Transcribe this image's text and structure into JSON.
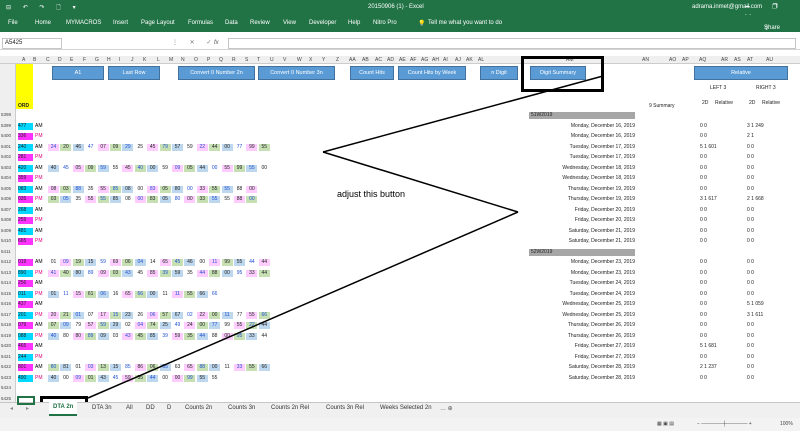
{
  "window": {
    "doc_title": "20150906 (1) - Excel",
    "email": "adrama.inmet@gmail.com",
    "qat": "⊟ ↶ ↷ 🗋 ▾",
    "controls": "🗕 ❐ ✕"
  },
  "ribbon": {
    "tabs": [
      "File",
      "Home",
      "MYMACROS",
      "Insert",
      "Page Layout",
      "Formulas",
      "Data",
      "Review",
      "View",
      "Developer",
      "Help",
      "Nitro Pro"
    ],
    "tell_me": "Tell me what you want to do",
    "share": "Share"
  },
  "formula_bar": {
    "name_box": "A5425",
    "fx": "fx",
    "icons": "⋮ ✕ ✓"
  },
  "columns": [
    "A",
    "B",
    "C",
    "D",
    "E",
    "F",
    "G",
    "H",
    "I",
    "J",
    "K",
    "L",
    "M",
    "N",
    "O",
    "P",
    "Q",
    "R",
    "S",
    "T",
    "U",
    "V",
    "W",
    "X",
    "Y",
    "Z",
    "AA",
    "AB",
    "AC",
    "AD",
    "AE",
    "AF",
    "AG",
    "AH",
    "AI",
    "AJ",
    "AK",
    "AL",
    "AM",
    "AN",
    "AO",
    "AP",
    "AQ",
    "AR",
    "AS",
    "AT",
    "AU"
  ],
  "buttons": [
    "A1",
    "Last Row",
    "Convert 0 Number 2n",
    "Convert 0 Number 3n",
    "Count Hits",
    "Count Hits by Week",
    "n Digit",
    "Digit Summary",
    "Relative"
  ],
  "header_cells": {
    "row1_num": "1",
    "col_a": "ORD",
    "nine_summary": "9 Summary",
    "left3": "LEFT 3",
    "right3": "RIGHT 3",
    "two_d": "2D",
    "relative": "Relative",
    "two_d_b": "2D",
    "relative_b": "Relative"
  },
  "row_numbers": [
    "5398",
    "5399",
    "5400",
    "5401",
    "5402",
    "5403",
    "5404",
    "5405",
    "5406",
    "5407",
    "5408",
    "5409",
    "5410",
    "5411",
    "5412",
    "5413",
    "5414",
    "5415",
    "5416",
    "5417",
    "5418",
    "5419",
    "5420",
    "5421",
    "5422",
    "5423",
    "5424",
    "5425",
    "5426"
  ],
  "rows": [
    {
      "a": "",
      "b": "",
      "nums": ""
    },
    {
      "a": "477",
      "b": "AM",
      "nums": ""
    },
    {
      "a": "336",
      "b": "PM",
      "nums": ""
    },
    {
      "a": "240",
      "b": "AM",
      "nums": "24 20 46 47 07 09 29 25 45 79 57 59 22 44 00 77 99 55"
    },
    {
      "a": "281",
      "b": "PM",
      "nums": ""
    },
    {
      "a": "420",
      "b": "AM",
      "nums": "40 45 05 09 59 55 45 40 00 59 09 05 44 00 55 99 55 00"
    },
    {
      "a": "359",
      "b": "PM",
      "nums": ""
    },
    {
      "a": "083",
      "b": "AM",
      "nums": "08 03 88 35 55 85 08 00 83 05 80 00 33 55 55 88 00"
    },
    {
      "a": "035",
      "b": "PM",
      "nums": "03 05 35 55 55 85 08 00 83 05 80 00 33 55 55 88 00"
    },
    {
      "a": "268",
      "b": "AM",
      "nums": ""
    },
    {
      "a": "259",
      "b": "PM",
      "nums": ""
    },
    {
      "a": "481",
      "b": "AM",
      "nums": ""
    },
    {
      "a": "665",
      "b": "PM",
      "nums": ""
    },
    {
      "a": "",
      "b": "",
      "nums": ""
    },
    {
      "a": "019",
      "b": "AM",
      "nums": "01 09 19 15 59 69 06 04 14 65 45 46 00 11 99 55 44 44"
    },
    {
      "a": "890",
      "b": "PM",
      "nums": "41 40 80 89 09 03 43 45 85 39 59 35 44 88 00 95 33 44"
    },
    {
      "a": "256",
      "b": "AM",
      "nums": ""
    },
    {
      "a": "011",
      "b": "PM",
      "nums": "01 11 15 61 06 16 65 66 00 11 11 55 66 66"
    },
    {
      "a": "437",
      "b": "AM",
      "nums": ""
    },
    {
      "a": "201",
      "b": "PM",
      "nums": "20 21 01 07 17 15 23 26 06 57 67 02 22 00 11 77 55 66"
    },
    {
      "a": "079",
      "b": "AM",
      "nums": "07 09 79 57 59 29 02 04 74 25 49 24 00 77 99 55 22 44"
    },
    {
      "a": "088",
      "b": "PM",
      "nums": "40 80 80 89 09 03 43 45 85 39 59 35 44 88 00 95 33 44"
    },
    {
      "a": "465",
      "b": "AM",
      "nums": ""
    },
    {
      "a": "244",
      "b": "PM",
      "nums": ""
    },
    {
      "a": "801",
      "b": "AM",
      "nums": "80 81 01 03 13 15 85 86 06 35 63 65 88 00 11 33 55 66"
    },
    {
      "a": "490",
      "b": "PM",
      "nums": "40 00 09 01 43 45 59 55 44 00 00 99 55 55"
    },
    {
      "a": "",
      "b": "",
      "nums": ""
    },
    {
      "a": "",
      "b": "",
      "nums": ""
    },
    {
      "a": "",
      "b": "",
      "nums": ""
    }
  ],
  "dates": [
    {
      "sep": "51W2019"
    },
    {
      "d": "Monday, December 16, 2019",
      "v": "0 0",
      "r": "3 1 249"
    },
    {
      "d": "Monday, December 16, 2019",
      "v": "0 0",
      "r": "2 1"
    },
    {
      "d": "Tuesday, December 17, 2019",
      "v": "5 1 601",
      "r": "0 0"
    },
    {
      "d": "Tuesday, December 17, 2019",
      "v": "0 0",
      "r": "0 0"
    },
    {
      "d": "Wednesday, December 18, 2019",
      "v": "0 0",
      "r": "0 0"
    },
    {
      "d": "Wednesday, December 18, 2019",
      "v": "0 0",
      "r": "0 0"
    },
    {
      "d": "Thursday, December 19, 2019",
      "v": "0 0",
      "r": "0 0"
    },
    {
      "d": "Thursday, December 19, 2019",
      "v": "3 1 617",
      "r": "2 1 668"
    },
    {
      "d": "Friday, December 20, 2019",
      "v": "0 0",
      "r": "0 0"
    },
    {
      "d": "Friday, December 20, 2019",
      "v": "0 0",
      "r": "0 0"
    },
    {
      "d": "Saturday, December 21, 2019",
      "v": "0 0",
      "r": "0 0"
    },
    {
      "d": "Saturday, December 21, 2019",
      "v": "0 0",
      "r": "0 0"
    },
    {
      "sep": "52W2019"
    },
    {
      "d": "Monday, December 23, 2019",
      "v": "0 0",
      "r": "0 0"
    },
    {
      "d": "Monday, December 23, 2019",
      "v": "0 0",
      "r": "0 0"
    },
    {
      "d": "Tuesday, December 24, 2019",
      "v": "0 0",
      "r": "0 0"
    },
    {
      "d": "Tuesday, December 24, 2019",
      "v": "0 0",
      "r": "0 0"
    },
    {
      "d": "Wednesday, December 25, 2019",
      "v": "0 0",
      "r": "5 1 059"
    },
    {
      "d": "Wednesday, December 25, 2019",
      "v": "0 0",
      "r": "3 1 611"
    },
    {
      "d": "Thursday, December 26, 2019",
      "v": "0 0",
      "r": "0 0"
    },
    {
      "d": "Thursday, December 26, 2019",
      "v": "0 0",
      "r": "0 0"
    },
    {
      "d": "Friday, December 27, 2019",
      "v": "5 1 681",
      "r": "0 0"
    },
    {
      "d": "Friday, December 27, 2019",
      "v": "0 0",
      "r": "0 0"
    },
    {
      "d": "Saturday, December 28, 2019",
      "v": "2 1 237",
      "r": "0 0"
    },
    {
      "d": "Saturday, December 28, 2019",
      "v": "0 0",
      "r": "0 0"
    }
  ],
  "sheet_tabs": [
    "DTA 2n",
    "DTA 3n",
    "All",
    "DD",
    "D",
    "Counts 2n",
    "Counts 3n",
    "Counts 2n Rel",
    "Counts 3n Rel",
    "Weeks Selected 2n"
  ],
  "annotation": "adjust this button",
  "status": {
    "zoom": "100%",
    "view_icons": "▦ ▣ ▤",
    "zoom_bar": "−  ──────┼──────  +"
  },
  "colors": {
    "excel_green": "#217346",
    "button_blue": "#5b9bd5",
    "cyan": "#00d8ff",
    "magenta": "#ff33ff",
    "green_cell": "#c6e0b4",
    "blue_cell": "#bdd7ee",
    "pink_cell": "#ffccff",
    "yellow_header": "#ffff00"
  }
}
